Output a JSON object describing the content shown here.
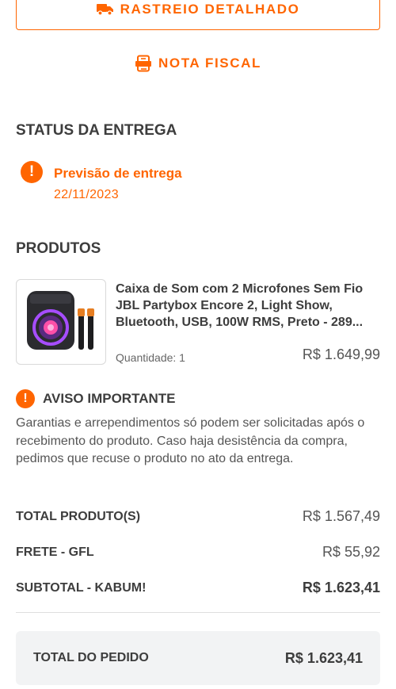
{
  "actions": {
    "tracking_label": "RASTREIO DETALHADO",
    "invoice_label": "NOTA FISCAL"
  },
  "delivery_status": {
    "title": "STATUS DA ENTREGA",
    "label": "Previsão de entrega",
    "date": "22/11/2023"
  },
  "products": {
    "title": "PRODUTOS",
    "items": [
      {
        "name": "Caixa de Som com 2 Microfones Sem Fio JBL Partybox Encore 2, Light Show, Bluetooth, USB, 100W RMS, Preto - 289...",
        "quantity": "Quantidade: 1",
        "price": "R$ 1.649,99"
      }
    ]
  },
  "notice": {
    "title": "AVISO IMPORTANTE",
    "text": "Garantias e arrependimentos só podem ser solicitadas após o recebimento do produto. Caso haja desistência da compra, pedimos que recuse o produto no ato da entrega."
  },
  "summary": {
    "rows": [
      {
        "label": "TOTAL PRODUTO(S)",
        "value": "R$ 1.567,49"
      },
      {
        "label": "FRETE - GFL",
        "value": "R$ 55,92"
      },
      {
        "label": "SUBTOTAL - KABUM!",
        "value": "R$ 1.623,41"
      }
    ],
    "total_label": "TOTAL DO PEDIDO",
    "total_value": "R$ 1.623,41"
  },
  "icons": {
    "truck": "truck-icon",
    "invoice": "invoice-icon",
    "alert": "alert-icon"
  },
  "colors": {
    "accent": "#ff6500",
    "text": "#3d3d3d",
    "total_bg": "#f2f3f4"
  }
}
